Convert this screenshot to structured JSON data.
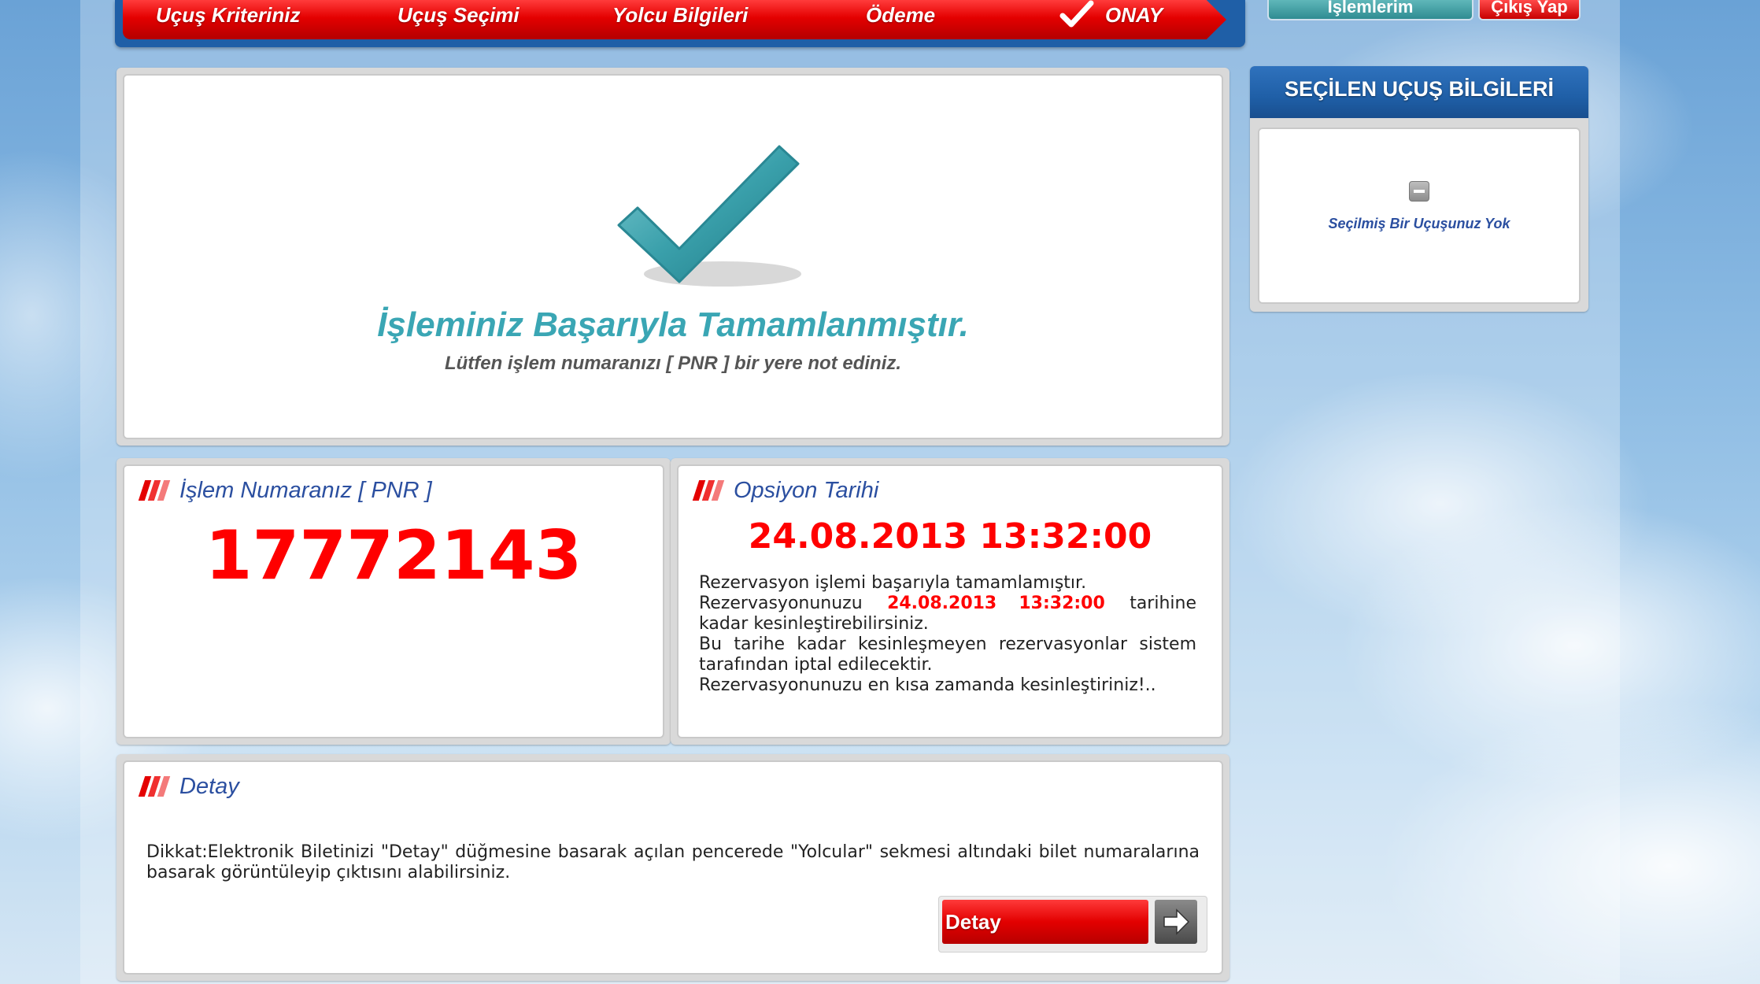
{
  "steps": {
    "items": [
      "Uçuş Kriteriniz",
      "Uçuş Seçimi",
      "Yolcu Bilgileri",
      "Ödeme",
      "ONAY"
    ]
  },
  "top_buttons": {
    "transactions": "İşlemlerim",
    "logout": "Çıkış Yap"
  },
  "success": {
    "title": "İşleminiz Başarıyla Tamamlanmıştır.",
    "subtitle": "Lütfen işlem numaranızı [ PNR ] bir yere not ediniz."
  },
  "pnr": {
    "heading": "İşlem Numaranız [ PNR ]",
    "value": "17772143"
  },
  "option": {
    "heading": "Opsiyon Tarihi",
    "datetime": "24.08.2013 13:32:00",
    "line1": "Rezervasyon işlemi başarıyla tamamlamıştır.",
    "line2_pre": "Rezervasyonunuzu",
    "line2_date": "24.08.2013  13:32:00",
    "line2_post": "tarihine kadar kesinleştirebilirsiniz.",
    "line3": "Bu tarihe kadar kesinleşmeyen rezervasyonlar sistem tarafından iptal edilecektir.",
    "line4": "Rezervasyonunuzu en kısa zamanda kesinleştiriniz!.."
  },
  "detail": {
    "heading": "Detay",
    "text": "Dikkat:Elektronik Biletinizi \"Detay\" düğmesine basarak açılan pencerede \"Yolcular\" sekmesi altındaki bilet numaralarına basarak görüntüleyip çıktısını alabilirsiniz.",
    "button_label": "Detay",
    "button_icon": "arrow-right-icon"
  },
  "selected_flight": {
    "heading": "SEÇİLEN UÇUŞ BİLGİLERİ",
    "empty_text": "Seçilmiş Bir Uçuşunuz Yok",
    "empty_icon": "minus-box-icon"
  },
  "colors": {
    "brand_red": "#e40000",
    "brand_blue": "#1f5fa7",
    "teal": "#3aa6b4",
    "heading_blue": "#2b4fa0"
  }
}
